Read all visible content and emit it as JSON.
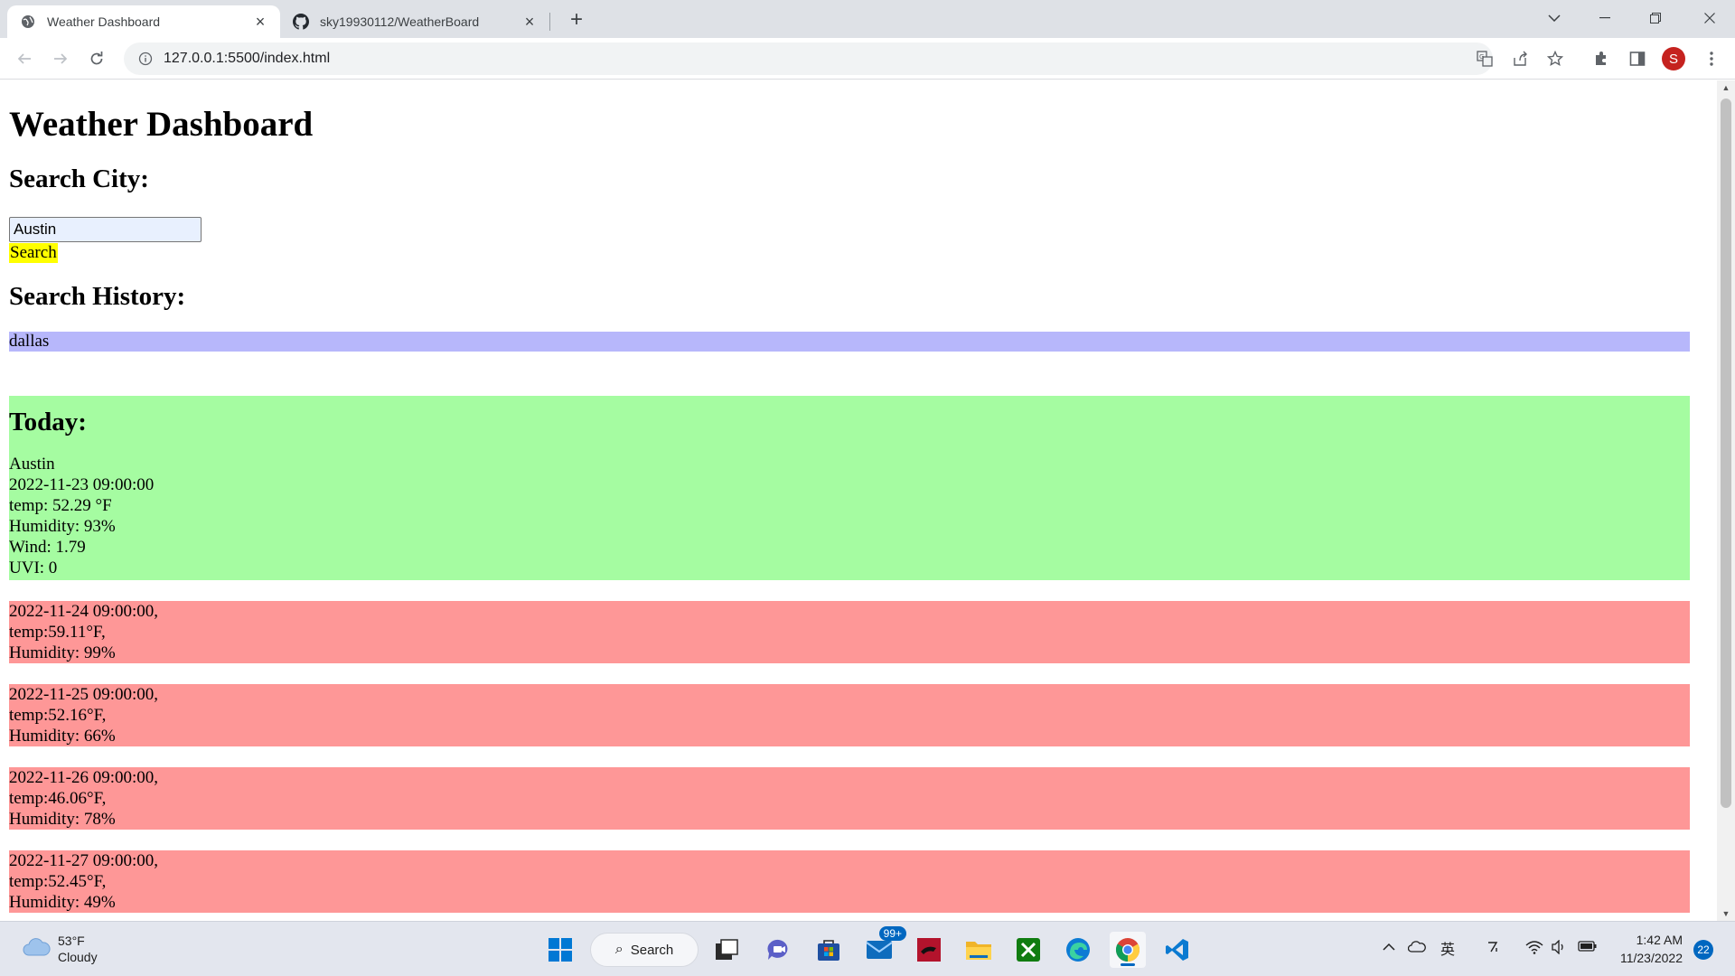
{
  "browser": {
    "tabs": [
      {
        "title": "Weather Dashboard",
        "icon": "globe-icon",
        "active": true
      },
      {
        "title": "sky19930112/WeatherBoard",
        "icon": "github-icon",
        "active": false
      }
    ],
    "url": "127.0.0.1:5500/index.html",
    "profile_initial": "S",
    "profile_color": "#c5221f"
  },
  "page": {
    "title": "Weather Dashboard",
    "search_heading": "Search City:",
    "search_value": "Austin",
    "search_button": "Search",
    "history_heading": "Search History:",
    "history": [
      "dallas"
    ],
    "today": {
      "heading": "Today:",
      "city": "Austin",
      "datetime": "2022-11-23 09:00:00",
      "temp": "temp: 52.29 °F",
      "humidity": "Humidity: 93%",
      "wind": "Wind: 1.79",
      "uvi": "UVI: 0"
    },
    "forecast": [
      {
        "date": "2022-11-24 09:00:00,",
        "temp": "temp:59.11°F,",
        "humidity": "Humidity: 99%"
      },
      {
        "date": "2022-11-25 09:00:00,",
        "temp": "temp:52.16°F,",
        "humidity": "Humidity: 66%"
      },
      {
        "date": "2022-11-26 09:00:00,",
        "temp": "temp:46.06°F,",
        "humidity": "Humidity: 78%"
      },
      {
        "date": "2022-11-27 09:00:00,",
        "temp": "temp:52.45°F,",
        "humidity": "Humidity: 49%"
      }
    ],
    "colors": {
      "search_button": "#ffff00",
      "history_item": "#b7b7fb",
      "today_card": "#a5fca1",
      "forecast_card": "#fe9797"
    }
  },
  "taskbar": {
    "weather_temp": "53°F",
    "weather_desc": "Cloudy",
    "search_label": "Search",
    "mail_badge": "99+",
    "ime": "英",
    "time": "1:42 AM",
    "date": "11/23/2022",
    "notifications": "22"
  }
}
